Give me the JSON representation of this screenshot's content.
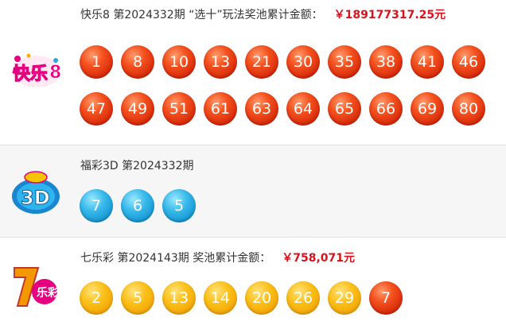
{
  "kl8": {
    "title": "快乐8 第2024332期 “选十”玩法奖池累计金额：",
    "amount": "￥189177317.25元",
    "logo_text": "快乐8",
    "row1": [
      "1",
      "8",
      "10",
      "13",
      "21",
      "30",
      "35",
      "38",
      "41",
      "46"
    ],
    "row2": [
      "47",
      "49",
      "51",
      "61",
      "63",
      "64",
      "65",
      "66",
      "69",
      "80"
    ]
  },
  "fc3d": {
    "title": "福彩3D 第2024332期",
    "logo_text": "3D",
    "balls": [
      "7",
      "6",
      "5"
    ]
  },
  "qlc": {
    "title": "七乐彩 第2024143期 奖池累计金额：",
    "amount": "￥758,071元",
    "logo_text": "7乐彩",
    "balls": [
      "2",
      "5",
      "13",
      "14",
      "20",
      "26",
      "29"
    ],
    "special": "7"
  },
  "colors": {
    "amount": "#d8121c",
    "red_ball": "#e8401a",
    "blue_ball": "#25a7de",
    "yellow_ball": "#f7b310",
    "row_alt_bg": "#f6f6f6"
  }
}
